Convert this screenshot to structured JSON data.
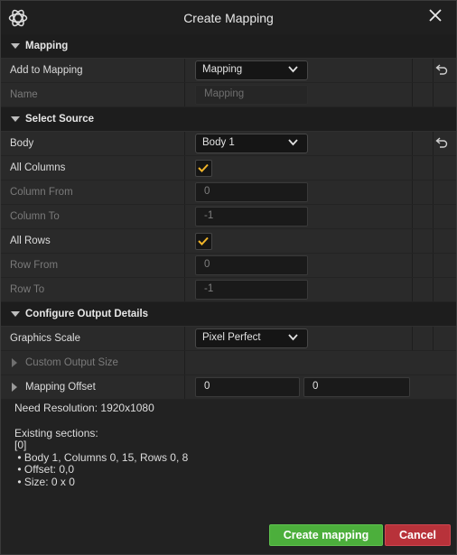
{
  "window": {
    "title": "Create Mapping"
  },
  "sections": {
    "mapping": "Mapping",
    "select_source": "Select Source",
    "configure_output": "Configure Output Details"
  },
  "fields": {
    "add_to_mapping": {
      "label": "Add to Mapping",
      "value": "Mapping"
    },
    "name": {
      "label": "Name",
      "placeholder": "Mapping"
    },
    "body": {
      "label": "Body",
      "value": "Body 1"
    },
    "all_columns": {
      "label": "All Columns",
      "checked": true
    },
    "column_from": {
      "label": "Column From",
      "value": "0"
    },
    "column_to": {
      "label": "Column To",
      "value": "-1"
    },
    "all_rows": {
      "label": "All Rows",
      "checked": true
    },
    "row_from": {
      "label": "Row From",
      "value": "0"
    },
    "row_to": {
      "label": "Row To",
      "value": "-1"
    },
    "graphics_scale": {
      "label": "Graphics Scale",
      "value": "Pixel Perfect"
    },
    "custom_output_size": {
      "label": "Custom Output Size"
    },
    "mapping_offset": {
      "label": "Mapping Offset",
      "x": "0",
      "y": "0"
    }
  },
  "info": {
    "need_resolution": "Need Resolution: 1920x1080",
    "existing_header": "Existing sections:",
    "index": "[0]",
    "line1": " • Body 1, Columns 0, 15, Rows 0, 8",
    "line2": " • Offset: 0,0",
    "line3": " • Size: 0 x 0"
  },
  "buttons": {
    "create": "Create mapping",
    "cancel": "Cancel"
  },
  "colors": {
    "accent_check": "#f0b429",
    "create_bg": "#4caf3c",
    "cancel_bg": "#b8323a"
  }
}
